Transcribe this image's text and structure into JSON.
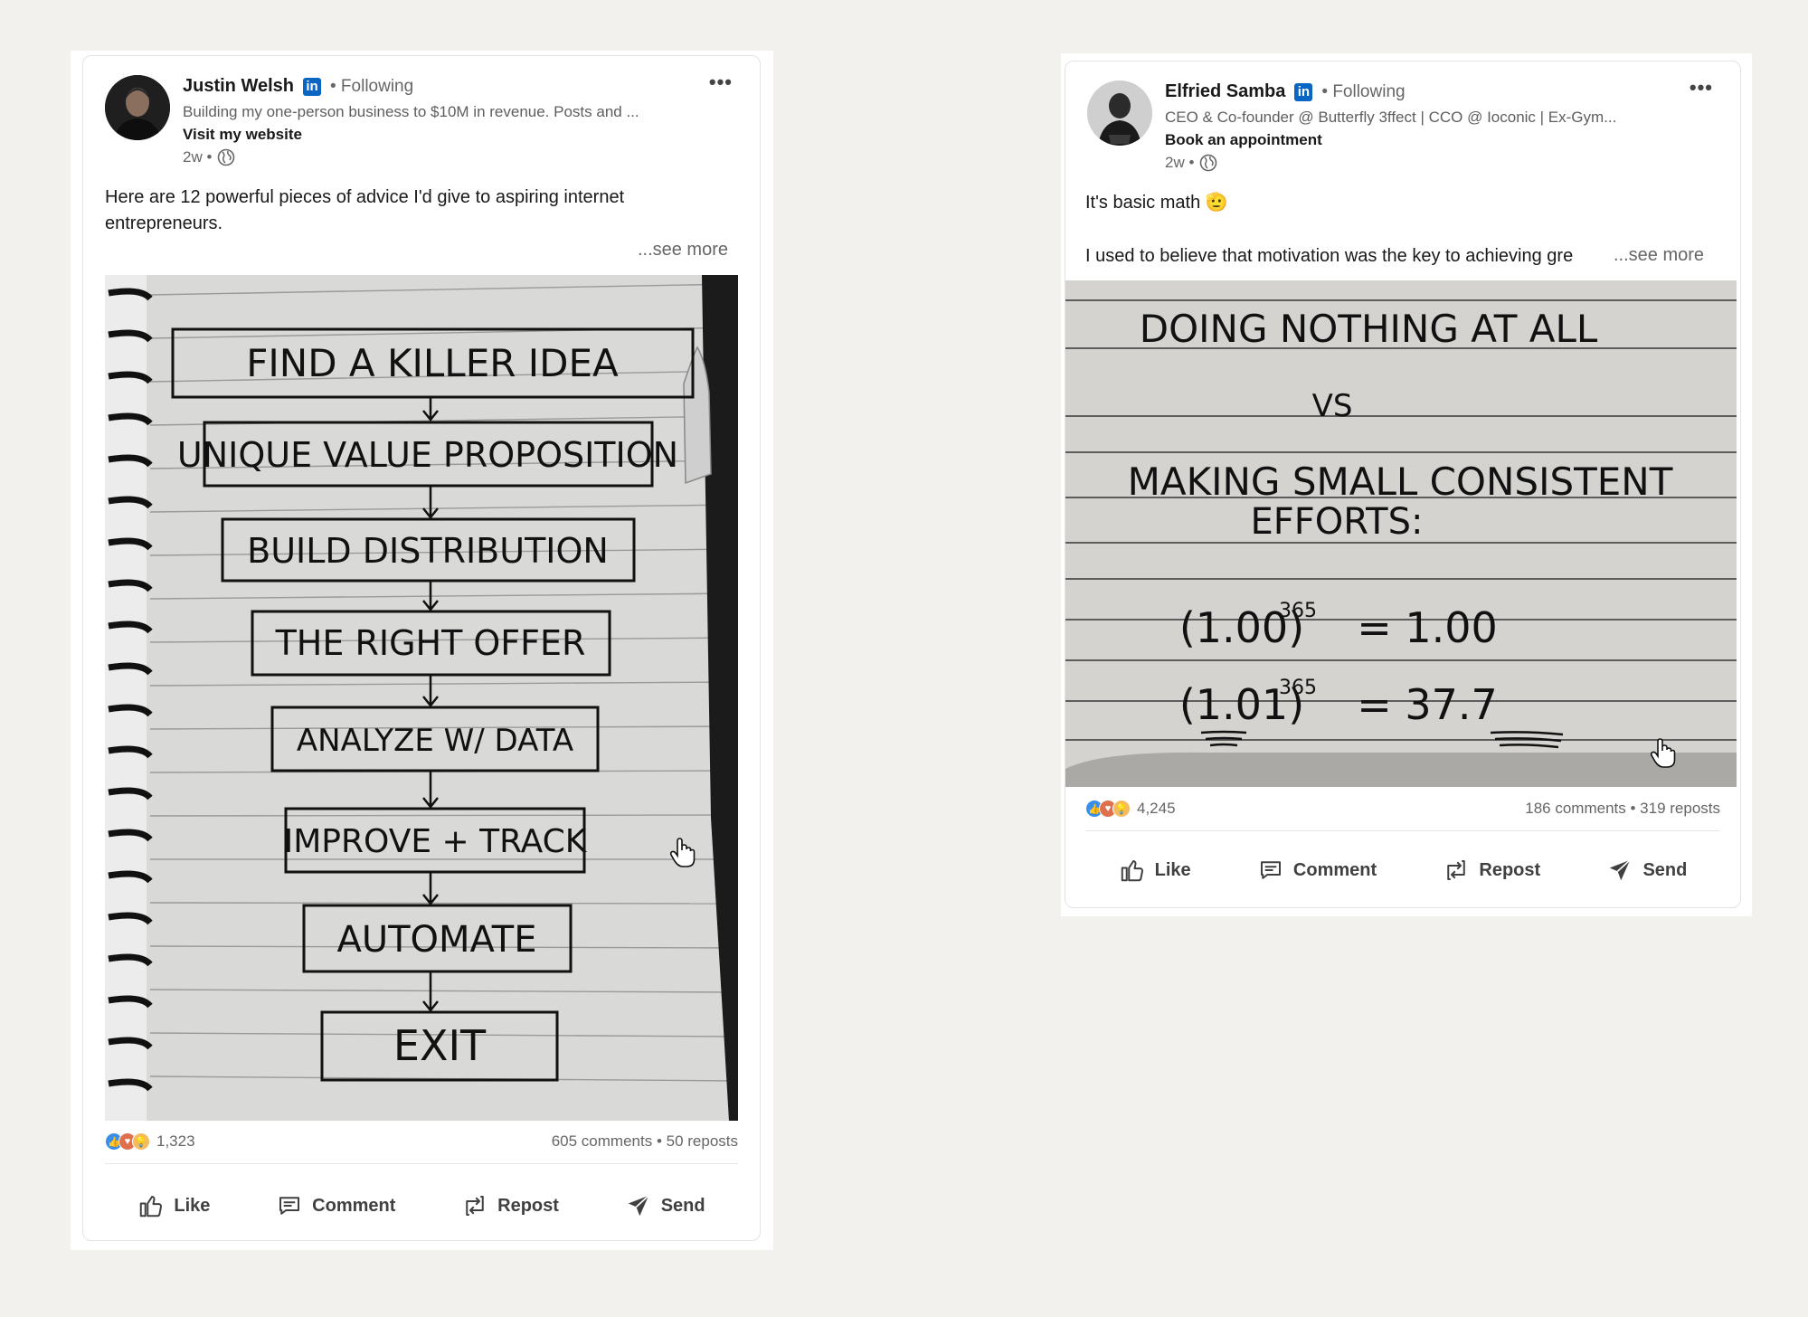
{
  "posts": [
    {
      "author": "Justin Welsh",
      "badge": "in",
      "follow_status": "• Following",
      "headline": "Building my one-person business to $10M in revenue. Posts and ...",
      "cta": "Visit my website",
      "time": "2w •",
      "text": "Here are 12 powerful pieces of advice I'd give to aspiring internet entrepreneurs.",
      "see_more": "...see more",
      "image_lines": [
        "FIND A KILLER IDEA",
        "UNIQUE VALUE PROPOSITION",
        "BUILD DISTRIBUTION",
        "THE RIGHT OFFER",
        "ANALYZE W/ DATA",
        "IMPROVE + TRACK",
        "AUTOMATE",
        "EXIT"
      ],
      "reaction_count": "1,323",
      "comments_reposts": "605 comments • 50 reposts",
      "actions": {
        "like": "Like",
        "comment": "Comment",
        "repost": "Repost",
        "send": "Send"
      }
    },
    {
      "author": "Elfried Samba",
      "badge": "in",
      "follow_status": "• Following",
      "headline": "CEO & Co-founder @ Butterfly 3ffect | CCO @ Ioconic | Ex-Gym...",
      "cta": "Book an appointment",
      "time": "2w •",
      "text_line1": "It's basic math 🫡",
      "text_line2": "I used to believe that motivation was the key to achieving gre",
      "see_more": "...see more",
      "image_lines": {
        "title": "DOING NOTHING AT ALL",
        "vs": "VS",
        "line2": "MAKING SMALL CONSISTENT",
        "line3": "EFFORTS:",
        "eq1_base": "(1.00)",
        "eq1_exp": "365",
        "eq1_result": "= 1.00",
        "eq2_base": "(1.01)",
        "eq2_exp": "365",
        "eq2_result": "= 37.7"
      },
      "reaction_count": "4,245",
      "comments_reposts": "186 comments • 319 reposts",
      "actions": {
        "like": "Like",
        "comment": "Comment",
        "repost": "Repost",
        "send": "Send"
      }
    }
  ],
  "colors": {
    "background": "#f2f1ee",
    "linkedin_blue": "#0a66c2",
    "text": "#191919",
    "muted": "#666666"
  }
}
